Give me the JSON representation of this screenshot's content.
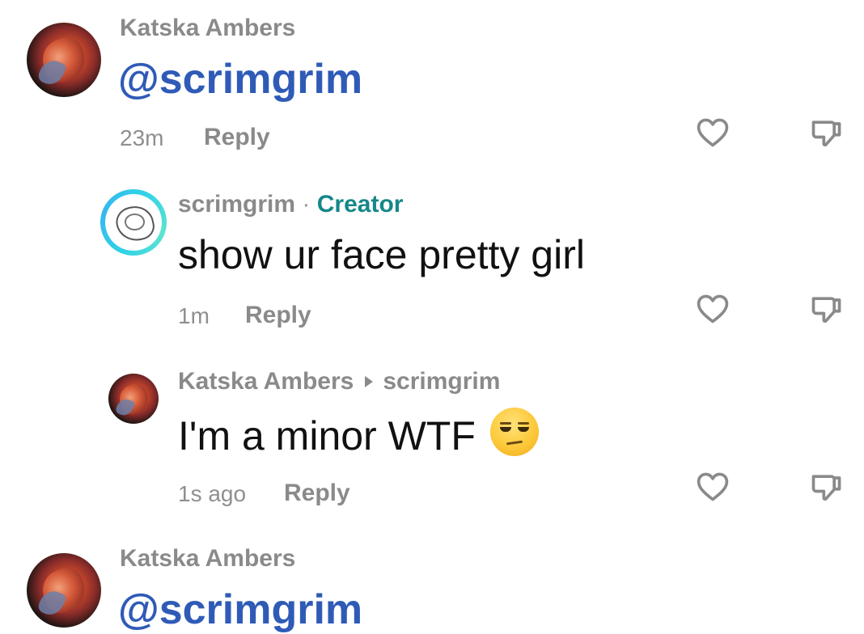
{
  "comments": [
    {
      "author": "Katska Ambers",
      "mention": "@scrimgrim",
      "time": "23m",
      "reply_label": "Reply"
    },
    {
      "author": "scrimgrim",
      "separator": " · ",
      "creator_badge": "Creator",
      "text": "show ur face pretty girl",
      "time": "1m",
      "reply_label": "Reply"
    },
    {
      "author": "Katska Ambers",
      "reply_to": "scrimgrim",
      "text": "I'm a minor WTF",
      "emoji": "unamused-face",
      "time": "1s ago",
      "reply_label": "Reply"
    },
    {
      "author": "Katska Ambers",
      "mention": "@scrimgrim"
    }
  ],
  "icons": {
    "like": "heart-outline-icon",
    "dislike": "thumbs-down-outline-icon"
  },
  "colors": {
    "mention": "#2f5bb7",
    "creator_badge": "#16878a",
    "creator_ring": "#2fd3e6",
    "muted": "#8a8a8a",
    "text": "#111111"
  }
}
